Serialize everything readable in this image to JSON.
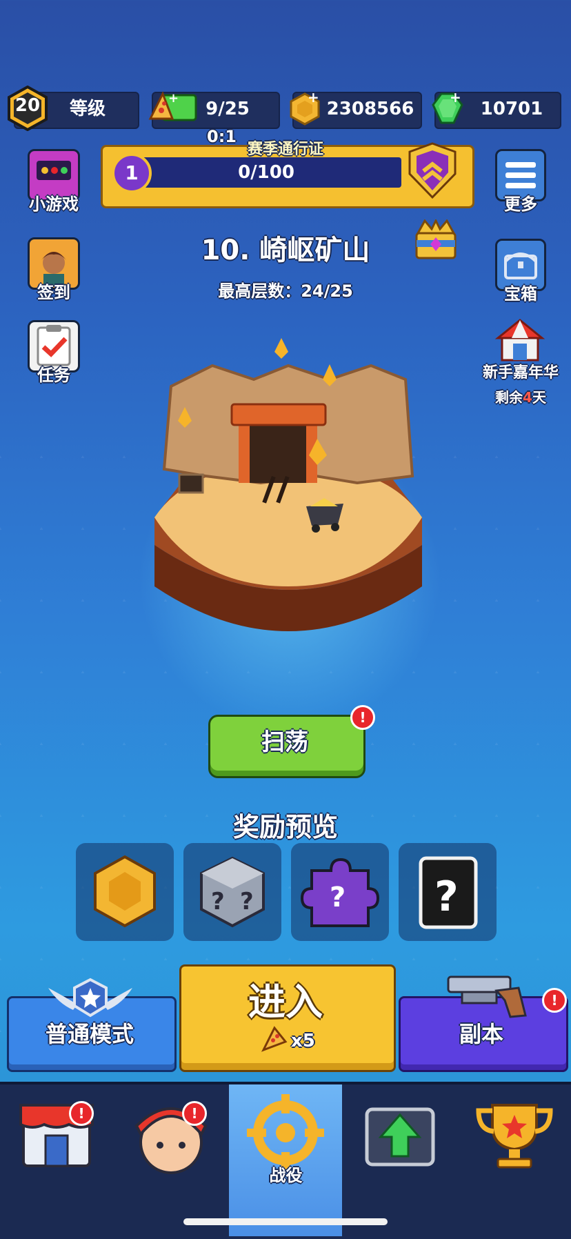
{
  "header": {
    "level_value": "20",
    "level_label": "等级",
    "energy": "9/25",
    "coins": "2308566",
    "gems": "10701",
    "timer": "0:1"
  },
  "season_pass": {
    "title": "赛季通行证",
    "level": "1",
    "progress": "0/100",
    "progress_fraction": 0
  },
  "left_menu": {
    "minigames": "小游戏",
    "checkin": "签到",
    "tasks": "任务"
  },
  "right_menu": {
    "more": "更多",
    "chests": "宝箱",
    "carnival": "新手嘉年华",
    "carnival_remaining_prefix": "剩余",
    "carnival_remaining_days": "4",
    "carnival_remaining_suffix": "天"
  },
  "stage": {
    "title": "10. 崎岖矿山",
    "best_label": "最高层数：",
    "best_value": "24/25"
  },
  "sweep_button": "扫荡",
  "rewards_title": "奖励预览",
  "rewards": [
    {
      "icon": "gold-coin-icon"
    },
    {
      "icon": "mystery-dice-icon"
    },
    {
      "icon": "mystery-puzzle-icon"
    },
    {
      "icon": "mystery-card-icon"
    }
  ],
  "actions": {
    "normal_mode": "普通模式",
    "enter": "进入",
    "enter_cost": "x5",
    "dungeon": "副本"
  },
  "nav": {
    "campaign_label": "战役",
    "alert_mark": "!"
  },
  "colors": {
    "accent_yellow": "#f7c431",
    "green_button": "#7fd13c",
    "blue_button": "#3a86e8",
    "purple_button": "#5c3fe0",
    "alert_red": "#e8262b"
  }
}
